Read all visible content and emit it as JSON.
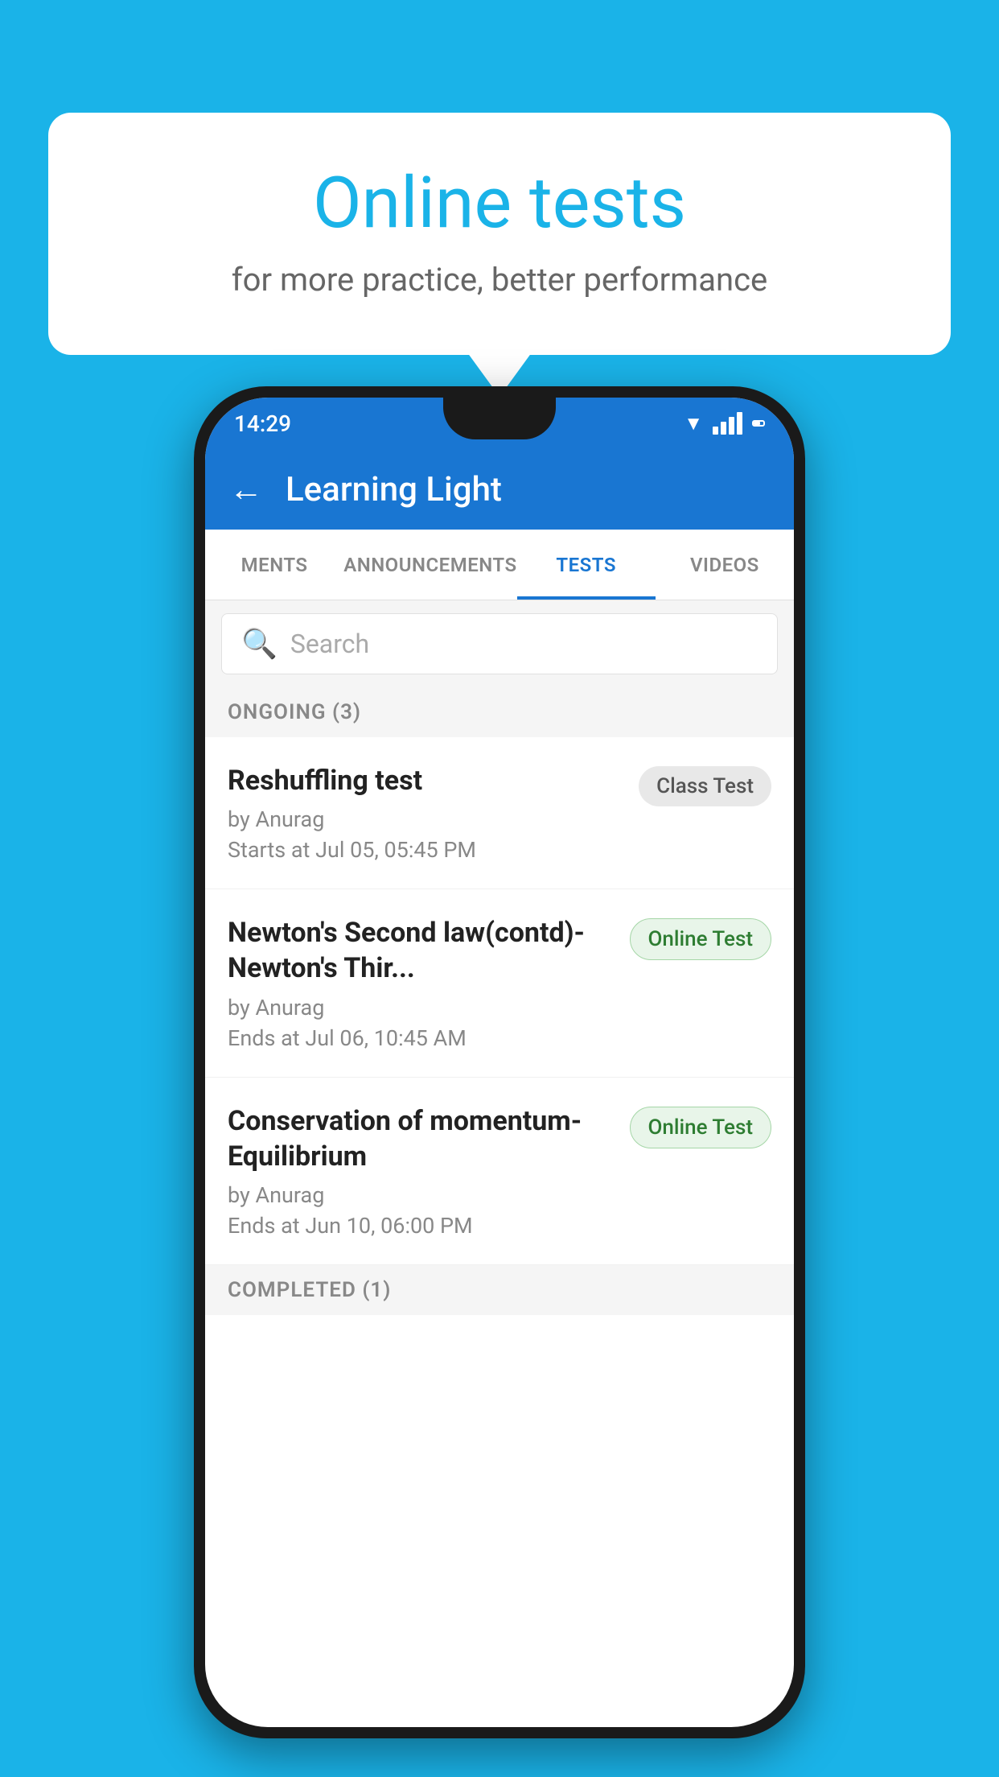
{
  "background": {
    "color": "#1ab3e8"
  },
  "speech_bubble": {
    "title": "Online tests",
    "subtitle": "for more practice, better performance"
  },
  "phone": {
    "status_bar": {
      "time": "14:29"
    },
    "app_bar": {
      "back_icon": "←",
      "title": "Learning Light"
    },
    "tabs": [
      {
        "label": "MENTS",
        "active": false
      },
      {
        "label": "ANNOUNCEMENTS",
        "active": false
      },
      {
        "label": "TESTS",
        "active": true
      },
      {
        "label": "VIDEOS",
        "active": false
      }
    ],
    "search": {
      "placeholder": "Search"
    },
    "ongoing_section": {
      "label": "ONGOING (3)"
    },
    "tests": [
      {
        "title": "Reshuffling test",
        "author": "by Anurag",
        "time_label": "Starts at",
        "time": "Jul 05, 05:45 PM",
        "badge": "Class Test",
        "badge_type": "class"
      },
      {
        "title": "Newton's Second law(contd)-Newton's Thir...",
        "author": "by Anurag",
        "time_label": "Ends at",
        "time": "Jul 06, 10:45 AM",
        "badge": "Online Test",
        "badge_type": "online"
      },
      {
        "title": "Conservation of momentum-Equilibrium",
        "author": "by Anurag",
        "time_label": "Ends at",
        "time": "Jun 10, 06:00 PM",
        "badge": "Online Test",
        "badge_type": "online"
      }
    ],
    "completed_section": {
      "label": "COMPLETED (1)"
    }
  }
}
